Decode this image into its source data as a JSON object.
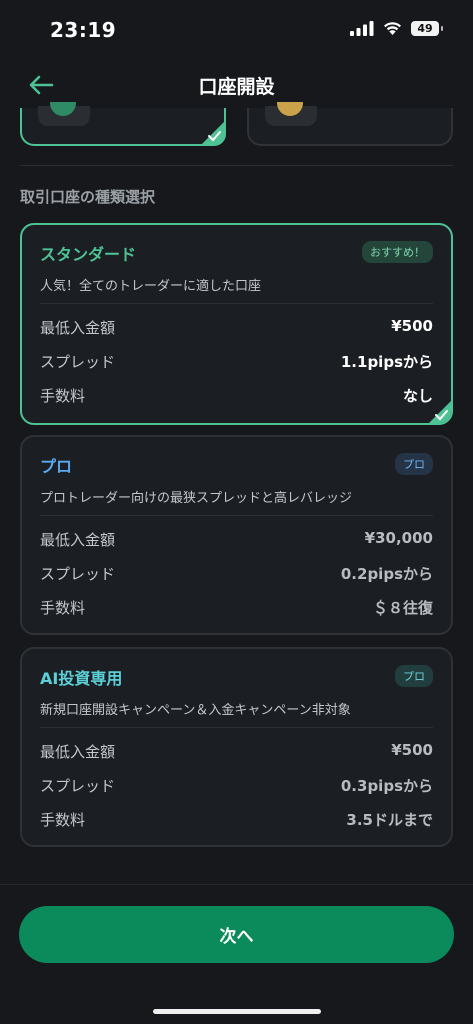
{
  "status_bar": {
    "time": "23:19",
    "battery": "49"
  },
  "header": {
    "title": "口座開設"
  },
  "section": {
    "title": "取引口座の種類選択"
  },
  "accounts": [
    {
      "name": "スタンダード",
      "badge": "おすすめ！",
      "description": "人気！全てのトレーダーに適した口座",
      "selected": true,
      "rows": [
        {
          "label": "最低入金額",
          "value": "¥500"
        },
        {
          "label": "スプレッド",
          "value": "1.1pipsから"
        },
        {
          "label": "手数料",
          "value": "なし"
        }
      ]
    },
    {
      "name": "プロ",
      "badge": "プロ",
      "description": "プロトレーダー向けの最狭スプレッドと高レバレッジ",
      "selected": false,
      "rows": [
        {
          "label": "最低入金額",
          "value": "¥30,000"
        },
        {
          "label": "スプレッド",
          "value": "0.2pipsから"
        },
        {
          "label": "手数料",
          "value": "＄８往復"
        }
      ]
    },
    {
      "name": "AI投資専用",
      "badge": "プロ",
      "description": "新規口座開設キャンペーン＆入金キャンペーン非対象",
      "selected": false,
      "rows": [
        {
          "label": "最低入金額",
          "value": "¥500"
        },
        {
          "label": "スプレッド",
          "value": "0.3pipsから"
        },
        {
          "label": "手数料",
          "value": "3.5ドルまで"
        }
      ]
    }
  ],
  "footer": {
    "next_label": "次へ"
  },
  "colors": {
    "accent_green": "#4ec295",
    "button_green": "#0b8a5c",
    "pro_blue": "#5aaaf0",
    "ai_teal": "#5cd0d8",
    "background": "#16181b"
  }
}
